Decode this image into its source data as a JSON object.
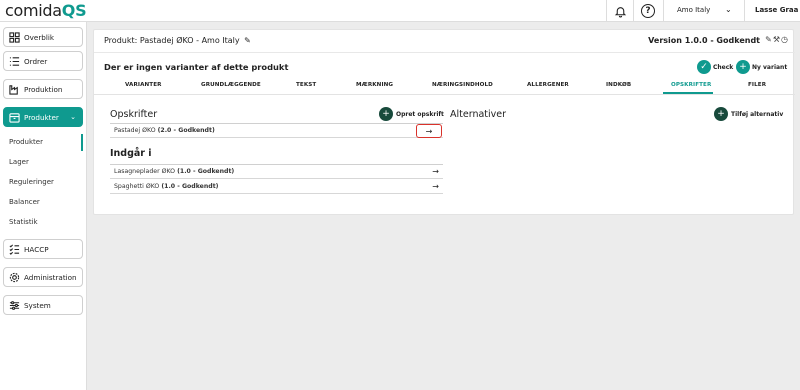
{
  "topbar": {
    "logo_prefix": "comida",
    "logo_suffix": "QS",
    "company": "Amo Italy",
    "user": "Lasse Graa"
  },
  "sidebar": {
    "items": [
      {
        "label": "Overblik",
        "icon": "grid-icon"
      },
      {
        "label": "Ordrer",
        "icon": "list-icon"
      },
      {
        "label": "Produktion",
        "icon": "factory-icon"
      },
      {
        "label": "Produkter",
        "icon": "box-icon",
        "active": true
      },
      {
        "label": "HACCP",
        "icon": "checklist-icon"
      },
      {
        "label": "Administration",
        "icon": "gear-icon"
      },
      {
        "label": "System",
        "icon": "sliders-icon"
      }
    ],
    "subitems": [
      "Produkter",
      "Lager",
      "Reguleringer",
      "Balancer",
      "Statistik"
    ]
  },
  "header": {
    "title": "Produkt: Pastadej ØKO - Amo Italy",
    "version": "Version 1.0.0 - Godkendt"
  },
  "variants": {
    "message": "Der er ingen varianter af dette produkt",
    "check_label": "Check",
    "new_variant_label": "Ny variant"
  },
  "tabs": [
    "VARIANTER",
    "GRUNDLÆGGENDE",
    "TEKST",
    "MÆRKNING",
    "NÆRINGSINDHOLD",
    "ALLERGENER",
    "INDKØB",
    "OPSKRIFTER",
    "FILER"
  ],
  "active_tab": "OPSKRIFTER",
  "recipes": {
    "title": "Opskrifter",
    "create_label": "Opret opskrift",
    "rows": [
      {
        "name": "Pastadej ØKO",
        "status": "(2.0 - Godkendt)"
      }
    ]
  },
  "included_in": {
    "title": "Indgår i",
    "rows": [
      {
        "name": "Lasagneplader ØKO",
        "status": "(1.0 - Godkendt)"
      },
      {
        "name": "Spaghetti ØKO",
        "status": "(1.0 - Godkendt)"
      }
    ]
  },
  "alternatives": {
    "title": "Alternativer",
    "add_label": "Tilføj alternativ"
  },
  "colors": {
    "accent": "#0f9a8f",
    "dark_button": "#184a3c",
    "highlight": "#d9322b"
  }
}
